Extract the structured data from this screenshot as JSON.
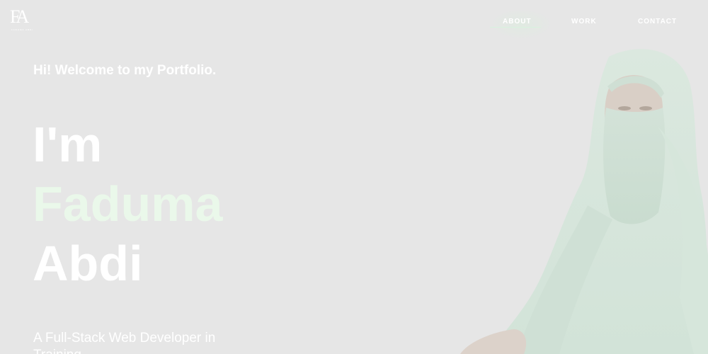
{
  "logo": {
    "mark": "FA",
    "sub": "FADUMA ABDI"
  },
  "nav": {
    "items": [
      {
        "label": "ABOUT"
      },
      {
        "label": "WORK"
      },
      {
        "label": "CONTACT"
      }
    ]
  },
  "hero": {
    "greeting": "Hi! Welcome to my Portfolio.",
    "line1": "I'm",
    "first_name": "Faduma",
    "last_name": "Abdi",
    "tagline": "A Full-Stack Web Developer in Training"
  },
  "colors": {
    "background": "#e6e6e6",
    "accent": "#eaf8ea",
    "text": "#ffffff"
  }
}
